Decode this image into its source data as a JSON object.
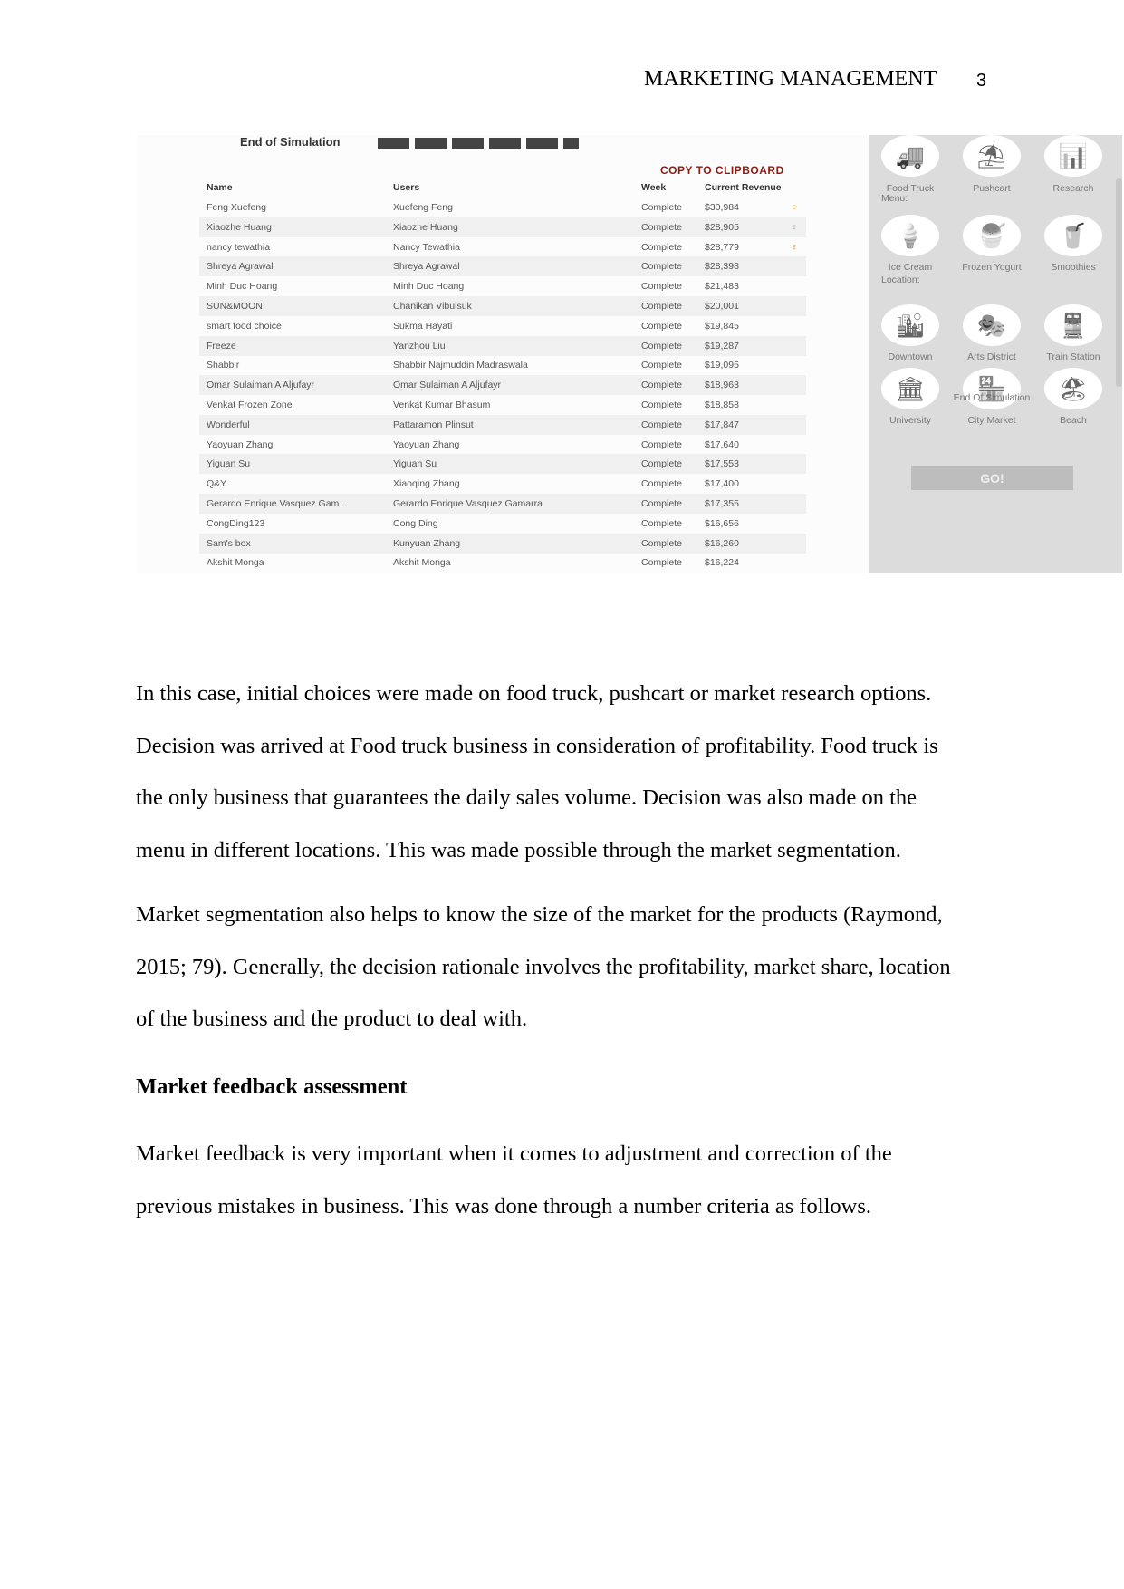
{
  "header": {
    "title": "MARKETING MANAGEMENT",
    "page_number": "3"
  },
  "screenshot": {
    "title": "End of Simulation",
    "copy_label": "COPY TO CLIPBOARD",
    "columns": [
      "Name",
      "Users",
      "Week",
      "Current Revenue"
    ],
    "rows": [
      {
        "name": "Feng Xuefeng",
        "user": "Xuefeng Feng",
        "week": "Complete",
        "revenue": "$30,984",
        "medal": "gold"
      },
      {
        "name": "Xiaozhe Huang",
        "user": "Xiaozhe Huang",
        "week": "Complete",
        "revenue": "$28,905",
        "medal": "silver"
      },
      {
        "name": "nancy tewathia",
        "user": "Nancy Tewathia",
        "week": "Complete",
        "revenue": "$28,779",
        "medal": "bronze"
      },
      {
        "name": "Shreya Agrawal",
        "user": "Shreya Agrawal",
        "week": "Complete",
        "revenue": "$28,398"
      },
      {
        "name": "Minh Duc Hoang",
        "user": "Minh Duc Hoang",
        "week": "Complete",
        "revenue": "$21,483"
      },
      {
        "name": "SUN&MOON",
        "user": "Chanikan Vibulsuk",
        "week": "Complete",
        "revenue": "$20,001"
      },
      {
        "name": "smart food choice",
        "user": "Sukma Hayati",
        "week": "Complete",
        "revenue": "$19,845"
      },
      {
        "name": "Freeze",
        "user": "Yanzhou Liu",
        "week": "Complete",
        "revenue": "$19,287"
      },
      {
        "name": "Shabbir",
        "user": "Shabbir Najmuddin Madraswala",
        "week": "Complete",
        "revenue": "$19,095"
      },
      {
        "name": "Omar Sulaiman A Aljufayr",
        "user": "Omar Sulaiman A Aljufayr",
        "week": "Complete",
        "revenue": "$18,963"
      },
      {
        "name": "Venkat Frozen Zone",
        "user": "Venkat Kumar Bhasum",
        "week": "Complete",
        "revenue": "$18,858"
      },
      {
        "name": "Wonderful",
        "user": "Pattaramon Plinsut",
        "week": "Complete",
        "revenue": "$17,847"
      },
      {
        "name": "Yaoyuan Zhang",
        "user": "Yaoyuan Zhang",
        "week": "Complete",
        "revenue": "$17,640"
      },
      {
        "name": "Yiguan Su",
        "user": "Yiguan Su",
        "week": "Complete",
        "revenue": "$17,553"
      },
      {
        "name": "Q&Y",
        "user": "Xiaoqing Zhang",
        "week": "Complete",
        "revenue": "$17,400"
      },
      {
        "name": "Gerardo Enrique Vasquez Gam...",
        "user": "Gerardo Enrique Vasquez Gamarra",
        "week": "Complete",
        "revenue": "$17,355"
      },
      {
        "name": "CongDing123",
        "user": "Cong Ding",
        "week": "Complete",
        "revenue": "$16,656"
      },
      {
        "name": "Sam's box",
        "user": "Kunyuan Zhang",
        "week": "Complete",
        "revenue": "$16,260"
      },
      {
        "name": "Akshit Monga",
        "user": "Akshit Monga",
        "week": "Complete",
        "revenue": "$16,224"
      }
    ],
    "medal_colors": {
      "gold": "#e8b830",
      "silver": "#aaaaaa",
      "bronze": "#d08a20"
    },
    "panel": {
      "business": [
        {
          "label": "Food Truck",
          "icon": "food-truck-icon"
        },
        {
          "label": "Pushcart",
          "icon": "pushcart-icon"
        },
        {
          "label": "Research",
          "icon": "research-icon"
        }
      ],
      "menu_label": "Menu:",
      "menu": [
        {
          "label": "Ice Cream",
          "icon": "ice-cream-icon"
        },
        {
          "label": "Frozen Yogurt",
          "icon": "frozen-yogurt-icon"
        },
        {
          "label": "Smoothies",
          "icon": "smoothie-icon"
        }
      ],
      "location_label": "Location:",
      "locations": [
        {
          "label": "Downtown",
          "icon": "downtown-icon"
        },
        {
          "label": "Arts District",
          "icon": "arts-district-icon"
        },
        {
          "label": "Train Station",
          "icon": "train-station-icon"
        },
        {
          "label": "University",
          "icon": "university-icon"
        },
        {
          "label": "City Market",
          "icon": "city-market-icon"
        },
        {
          "label": "Beach",
          "icon": "beach-icon"
        }
      ],
      "status": "End Of Simulation",
      "go_label": "GO!"
    }
  },
  "body": {
    "p1": [
      "In this case, initial choices were made on food truck, pushcart or market research options.",
      "Decision was arrived at Food truck business in consideration of profitability. Food truck is",
      "the only business that guarantees the daily sales volume. Decision was also made on the",
      "menu in different locations. This was made possible through the market segmentation."
    ],
    "p2": [
      "Market segmentation also helps to know the size of the market for the products (Raymond,",
      "2015; 79). Generally, the decision rationale involves the profitability, market share, location",
      "of the business and the product to deal with."
    ],
    "heading": "Market feedback assessment",
    "p3": [
      "Market feedback is very important when it comes to adjustment and correction of the",
      "previous mistakes in business. This was done through a number criteria as follows."
    ]
  }
}
